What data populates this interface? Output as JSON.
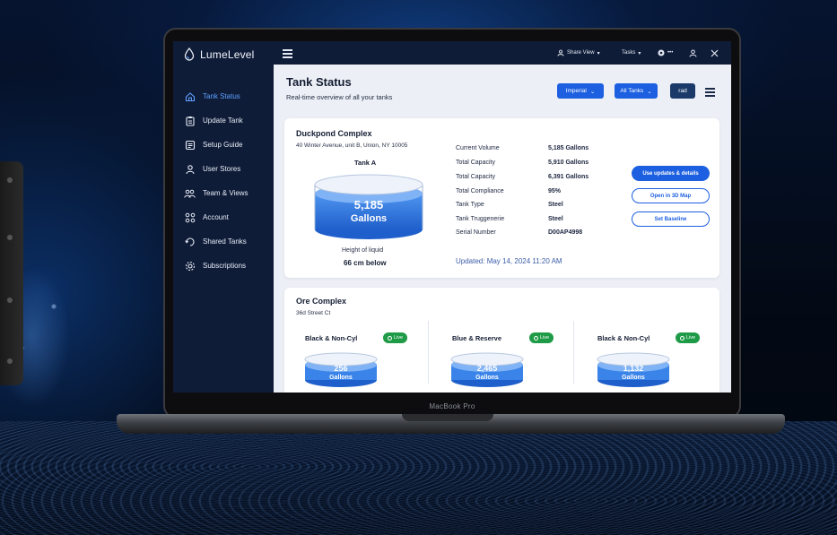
{
  "brand": {
    "name": "LumeLevel"
  },
  "sidebar": {
    "items": [
      {
        "label": "Tank Status",
        "icon": "home-icon",
        "active": true
      },
      {
        "label": "Update Tank",
        "icon": "clipboard-icon"
      },
      {
        "label": "Setup Guide",
        "icon": "book-icon"
      },
      {
        "label": "User Stores",
        "icon": "user-store-icon"
      },
      {
        "label": "Team & Views",
        "icon": "team-icon"
      },
      {
        "label": "Account",
        "icon": "account-icon"
      },
      {
        "label": "Shared Tanks",
        "icon": "share-icon"
      },
      {
        "label": "Subscriptions",
        "icon": "gear-icon"
      }
    ]
  },
  "topbar": {
    "share_view": "Share View",
    "tasks": "Tasks",
    "status_small": "•••"
  },
  "header": {
    "title": "Tank Status",
    "subtitle": "Real-time overview of all your tanks",
    "unit_select": "Imperial",
    "tank_filter": "All Tanks",
    "dark_button": "rad"
  },
  "primary_site": {
    "name": "Duckpond Complex",
    "address": "40 Winter Avenue, unit B, Union, NY 10005",
    "tank_name": "Tank A",
    "volume_value": "5,185",
    "volume_unit": "Gallons",
    "height_label": "Height of liquid",
    "height_value": "66 cm below",
    "details": [
      {
        "label": "Current Volume",
        "value": "5,185 Gallons"
      },
      {
        "label": "Total Capacity",
        "value": "5,910 Gallons"
      },
      {
        "label": "Total Capacity",
        "value": "6,391 Gallons"
      },
      {
        "label": "Total Compliance",
        "value": "95%"
      },
      {
        "label": "Tank Type",
        "value": "Steel"
      },
      {
        "label": "Tank Truggenerie",
        "value": "Steel"
      },
      {
        "label": "Serial Number",
        "value": "D00AP4998"
      }
    ],
    "updated": "Updated: May 14, 2024 11:20 AM",
    "actions": {
      "primary": "Use updates & details",
      "map": "Open in 3D Map",
      "baseline": "Set Baseline"
    }
  },
  "secondary_site": {
    "name": "Ore Complex",
    "address": "36d Street Ct",
    "tanks": [
      {
        "name": "Black & Non-Cyl",
        "status": "Live",
        "value": "256",
        "unit": "Gallons"
      },
      {
        "name": "Blue & Reserve",
        "status": "Live",
        "value": "2,465",
        "unit": "Gallons"
      },
      {
        "name": "Black & Non-Cyl",
        "status": "Live",
        "value": "1,132",
        "unit": "Gallons"
      }
    ]
  },
  "laptop": {
    "label": "MacBook Pro"
  },
  "colors": {
    "accent": "#1c5fe0",
    "sidebar": "#0f1c38",
    "live": "#1f9a46",
    "liquid": "#2f7ae0"
  }
}
